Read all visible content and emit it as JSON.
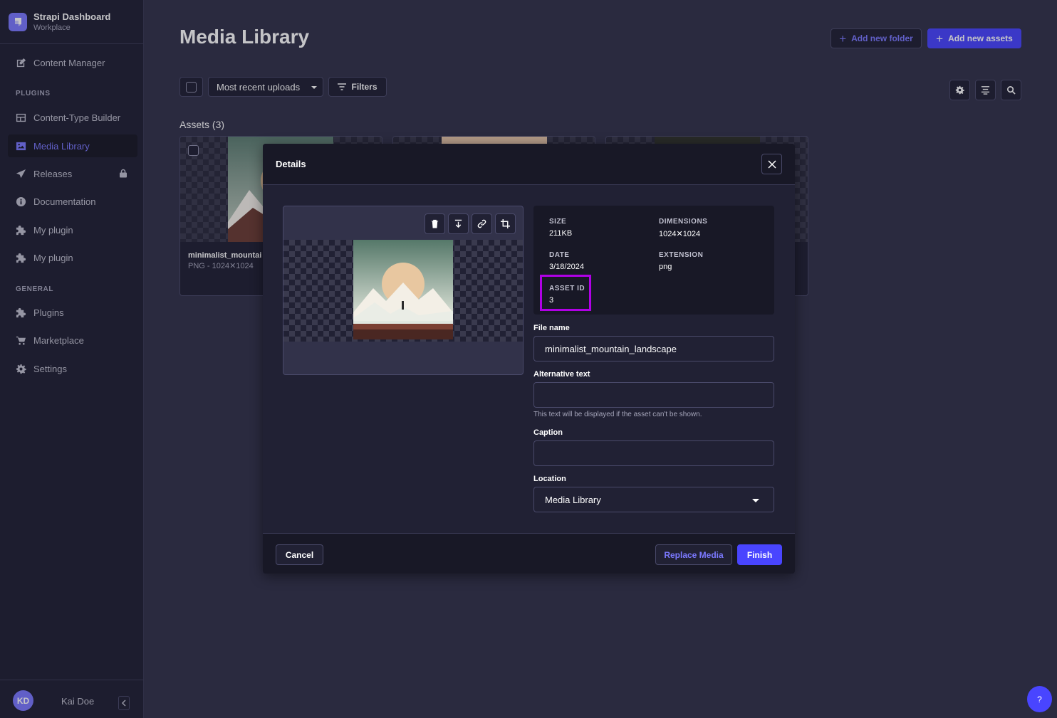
{
  "brand": {
    "title": "Strapi Dashboard",
    "subtitle": "Workplace"
  },
  "sidebar": {
    "items": [
      {
        "label": "Content Manager",
        "icon": "content-manager-icon"
      },
      {
        "label": "Content-Type Builder",
        "icon": "layout-icon"
      },
      {
        "label": "Media Library",
        "icon": "image-icon",
        "active": true
      },
      {
        "label": "Releases",
        "icon": "paper-plane-icon",
        "locked": true
      },
      {
        "label": "Documentation",
        "icon": "info-icon"
      },
      {
        "label": "My plugin",
        "icon": "puzzle-icon"
      },
      {
        "label": "My plugin",
        "icon": "puzzle-icon"
      },
      {
        "label": "Plugins",
        "icon": "puzzle-icon"
      },
      {
        "label": "Marketplace",
        "icon": "cart-icon"
      },
      {
        "label": "Settings",
        "icon": "gear-icon"
      }
    ],
    "sections": {
      "plugins": "PLUGINS",
      "general": "GENERAL"
    }
  },
  "user": {
    "initials": "KD",
    "name": "Kai Doe"
  },
  "header": {
    "title": "Media Library",
    "add_folder": "Add new folder",
    "add_assets": "Add new assets"
  },
  "toolbar": {
    "sort": "Most recent uploads",
    "filters": "Filters"
  },
  "assets": {
    "heading": "Assets (3)",
    "cards": [
      {
        "name": "minimalist_mountai",
        "meta": "PNG - 1024✕1024"
      }
    ]
  },
  "modal": {
    "title": "Details",
    "meta": {
      "size_label": "SIZE",
      "size": "211KB",
      "dimensions_label": "DIMENSIONS",
      "dimensions": "1024✕1024",
      "date_label": "DATE",
      "date": "3/18/2024",
      "extension_label": "EXTENSION",
      "extension": "png",
      "asset_id_label": "ASSET ID",
      "asset_id": "3"
    },
    "fields": {
      "file_name_label": "File name",
      "file_name": "minimalist_mountain_landscape",
      "alt_label": "Alternative text",
      "alt_value": "",
      "alt_hint": "This text will be displayed if the asset can't be shown.",
      "caption_label": "Caption",
      "caption_value": "",
      "location_label": "Location",
      "location": "Media Library"
    },
    "footer": {
      "cancel": "Cancel",
      "replace": "Replace Media",
      "finish": "Finish"
    }
  },
  "help": {
    "label": "?"
  },
  "colors": {
    "accent": "#4945ff",
    "accent_text": "#7b79ff",
    "highlight": "#b000e6",
    "background": "#32324a",
    "surface": "#212134"
  }
}
